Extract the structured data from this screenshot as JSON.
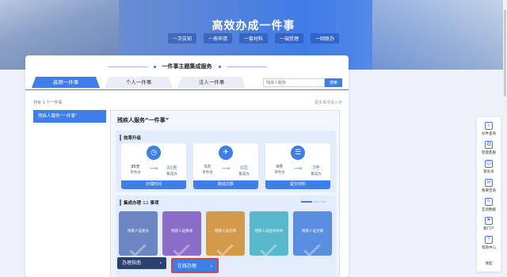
{
  "banner": {
    "title": "高效办成一件事",
    "tags": [
      "一次告知",
      "一表申请",
      "一套材料",
      "一端受理",
      "一网联办"
    ]
  },
  "section": {
    "title": "一件事主题集成服务"
  },
  "tabs": [
    {
      "label": "高频一件事",
      "active": true
    },
    {
      "label": "个人一件事",
      "active": false
    },
    {
      "label": "法人一件事",
      "active": false
    }
  ],
  "search": {
    "placeholder": "残疾人服务",
    "button": "搜索"
  },
  "list": {
    "count_text": "共有 1 个一件事",
    "more_text": "更多事项请入中"
  },
  "sidebar": {
    "item": "残疾人服务“一件事”"
  },
  "content": {
    "title": "残疾人服务“一件事”",
    "efficiency": {
      "label": "效率升级",
      "cards": [
        {
          "icon": "clock-icon",
          "icon_glyph": "◷",
          "before_value": "95天",
          "before_label": "单件办",
          "after_value": "30天",
          "after_label": "集成办",
          "footer": "办理时间"
        },
        {
          "icon": "running-icon",
          "icon_glyph": "✈",
          "before_value": "5次",
          "before_label": "单件办",
          "after_value": "0次",
          "after_label": "集成办",
          "footer": "跑动次数"
        },
        {
          "icon": "document-icon",
          "icon_glyph": "☰",
          "before_value": "8件",
          "before_label": "单件办",
          "after_value": "7件",
          "after_label": "集成办",
          "footer": "提交材料"
        }
      ]
    },
    "integrated": {
      "label": "集成办理",
      "count": "12",
      "unit": "事项",
      "tiles": [
        {
          "label": "残疾人证新办",
          "color": "#6c86c4"
        },
        {
          "label": "残疾人证换领",
          "color": "#8a6dc7"
        },
        {
          "label": "残疾人证迁移",
          "color": "#d49a4c"
        },
        {
          "label": "残疾人证挂失补办",
          "color": "#59b9cc"
        },
        {
          "label": "残疾人证注销",
          "color": "#5a8ee0"
        }
      ]
    },
    "buttons": {
      "guide": "办理指南",
      "online": "在线办理"
    }
  },
  "float_bar": [
    {
      "icon": "search-doc-icon",
      "glyph": "⌕",
      "label": "办件查询"
    },
    {
      "icon": "smart-tips-icon",
      "glyph": "✪",
      "label": "智能客服"
    },
    {
      "icon": "user-icon",
      "glyph": "☺",
      "label": "帮办员"
    },
    {
      "icon": "chat-icon",
      "glyph": "✉",
      "label": "我要咨询"
    },
    {
      "icon": "interaction-icon",
      "glyph": "✎",
      "label": "互动数据"
    },
    {
      "icon": "flag-icon",
      "glyph": "⚑",
      "label": "跳门户"
    },
    {
      "icon": "help-icon",
      "glyph": "?",
      "label": "帮助中心"
    },
    {
      "icon": "collapse-icon",
      "glyph": "",
      "label": "收起"
    }
  ]
}
